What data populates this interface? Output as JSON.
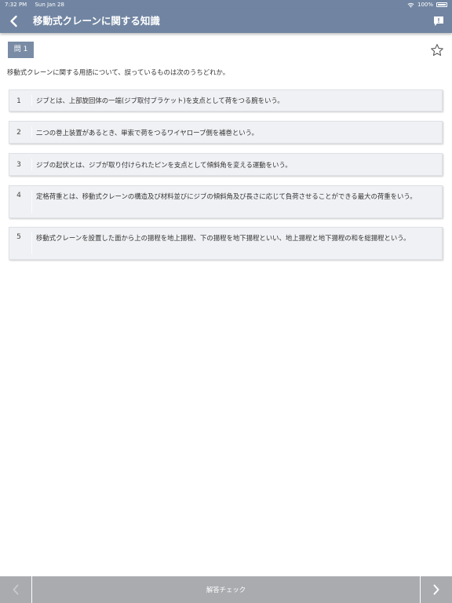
{
  "status": {
    "time": "7:32 PM",
    "date": "Sun Jan 28",
    "battery": "100%"
  },
  "nav": {
    "title": "移動式クレーンに関する知識"
  },
  "question": {
    "badge": "問 1",
    "text": "移動式クレーンに関する用語について、誤っているものは次のうちどれか。"
  },
  "choices": [
    {
      "number": "1",
      "text": "ジブとは、上部旋回体の一端(ジブ取付ブラケット)を支点として荷をつる腕をいう。"
    },
    {
      "number": "2",
      "text": "二つの巻上装置があるとき、単索で荷をつるワイヤロープ側を補巻という。"
    },
    {
      "number": "3",
      "text": "ジブの起伏とは、ジブが取り付けられたピンを支点として傾斜角を変える運動をいう。"
    },
    {
      "number": "4",
      "text": "定格荷重とは、移動式クレーンの構造及び材料並びにジブの傾斜角及び長さに応じて負荷させることができる最大の荷重をいう。"
    },
    {
      "number": "5",
      "text": "移動式クレーンを設置した面から上の揚程を地上揚程、下の揚程を地下揚程といい、地上揚程と地下揚程の和を総揚程という。"
    }
  ],
  "footer": {
    "check_label": "解答チェック"
  },
  "icons": {
    "back": "chevron-left-icon",
    "comment": "comment-icon",
    "star": "star-outline-icon",
    "prev": "chevron-left-icon",
    "next": "chevron-right-icon"
  },
  "colors": {
    "header": "#7185a2",
    "badge": "#7a8ca5",
    "footer": "#a9abaf",
    "choice_bg": "#f0f1f4"
  }
}
